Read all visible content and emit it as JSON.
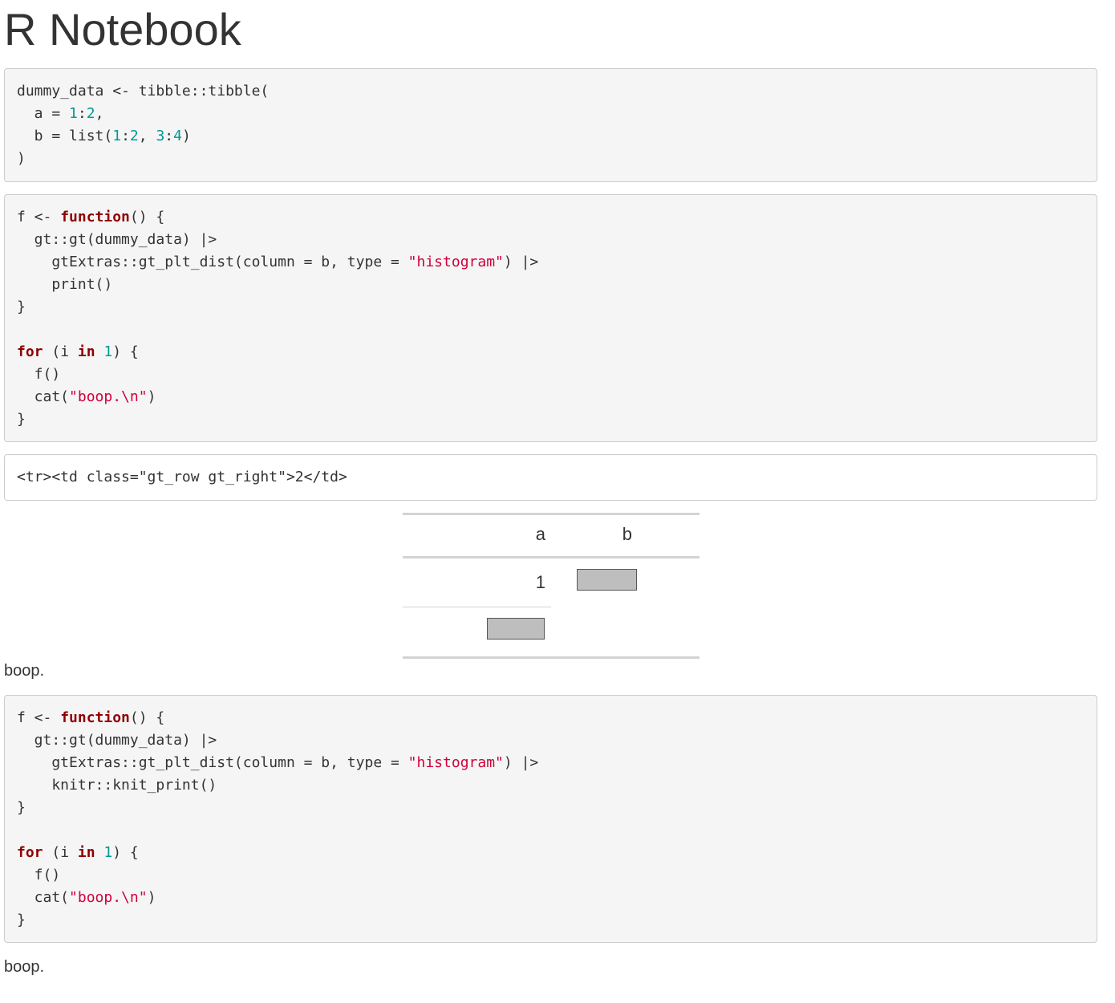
{
  "page": {
    "title": "R Notebook"
  },
  "chunks": [
    {
      "kind": "source",
      "lines": [
        [
          {
            "t": "dummy_data <- tibble::tibble("
          }
        ],
        [
          {
            "t": "  a = "
          },
          {
            "t": "1",
            "c": "num"
          },
          {
            "t": ":"
          },
          {
            "t": "2",
            "c": "num"
          },
          {
            "t": ","
          }
        ],
        [
          {
            "t": "  b = list("
          },
          {
            "t": "1",
            "c": "num"
          },
          {
            "t": ":"
          },
          {
            "t": "2",
            "c": "num"
          },
          {
            "t": ", "
          },
          {
            "t": "3",
            "c": "num"
          },
          {
            "t": ":"
          },
          {
            "t": "4",
            "c": "num"
          },
          {
            "t": ")"
          }
        ],
        [
          {
            "t": ")"
          }
        ]
      ]
    },
    {
      "kind": "source",
      "lines": [
        [
          {
            "t": "f <- "
          },
          {
            "t": "function",
            "c": "kw"
          },
          {
            "t": "() {"
          }
        ],
        [
          {
            "t": "  gt::gt(dummy_data) |>"
          }
        ],
        [
          {
            "t": "    gtExtras::gt_plt_dist(column = b, type = "
          },
          {
            "t": "\"histogram\"",
            "c": "str"
          },
          {
            "t": ") |>"
          }
        ],
        [
          {
            "t": "    print()"
          }
        ],
        [
          {
            "t": "}"
          }
        ],
        [
          {
            "t": ""
          }
        ],
        [
          {
            "t": "for",
            "c": "kw"
          },
          {
            "t": " (i "
          },
          {
            "t": "in",
            "c": "kw"
          },
          {
            "t": " "
          },
          {
            "t": "1",
            "c": "num"
          },
          {
            "t": ") {"
          }
        ],
        [
          {
            "t": "  f()"
          }
        ],
        [
          {
            "t": "  cat("
          },
          {
            "t": "\"boop.\\n\"",
            "c": "str"
          },
          {
            "t": ")"
          }
        ],
        [
          {
            "t": "}"
          }
        ]
      ]
    },
    {
      "kind": "output",
      "lines": [
        [
          {
            "t": "<tr><td class=\"gt_row gt_right\">2</td>"
          }
        ]
      ]
    },
    {
      "kind": "source",
      "lines": [
        [
          {
            "t": "f <- "
          },
          {
            "t": "function",
            "c": "kw"
          },
          {
            "t": "() {"
          }
        ],
        [
          {
            "t": "  gt::gt(dummy_data) |>"
          }
        ],
        [
          {
            "t": "    gtExtras::gt_plt_dist(column = b, type = "
          },
          {
            "t": "\"histogram\"",
            "c": "str"
          },
          {
            "t": ") |>"
          }
        ],
        [
          {
            "t": "    knitr::knit_print()"
          }
        ],
        [
          {
            "t": "}"
          }
        ],
        [
          {
            "t": ""
          }
        ],
        [
          {
            "t": "for",
            "c": "kw"
          },
          {
            "t": " (i "
          },
          {
            "t": "in",
            "c": "kw"
          },
          {
            "t": " "
          },
          {
            "t": "1",
            "c": "num"
          },
          {
            "t": ") {"
          }
        ],
        [
          {
            "t": "  f()"
          }
        ],
        [
          {
            "t": "  cat("
          },
          {
            "t": "\"boop.\\n\"",
            "c": "str"
          },
          {
            "t": ")"
          }
        ],
        [
          {
            "t": "}"
          }
        ]
      ]
    }
  ],
  "gt_table": {
    "columns": [
      "a",
      "b"
    ],
    "rows": [
      {
        "a": "1"
      }
    ],
    "histogram_fill": "#bebebe"
  },
  "outputs": {
    "boop_1": "boop.",
    "boop_2": "boop."
  },
  "colors": {
    "keyword": "#8f0000",
    "number": "#009999",
    "string": "#d1003a",
    "code_bg": "#f5f5f5"
  }
}
